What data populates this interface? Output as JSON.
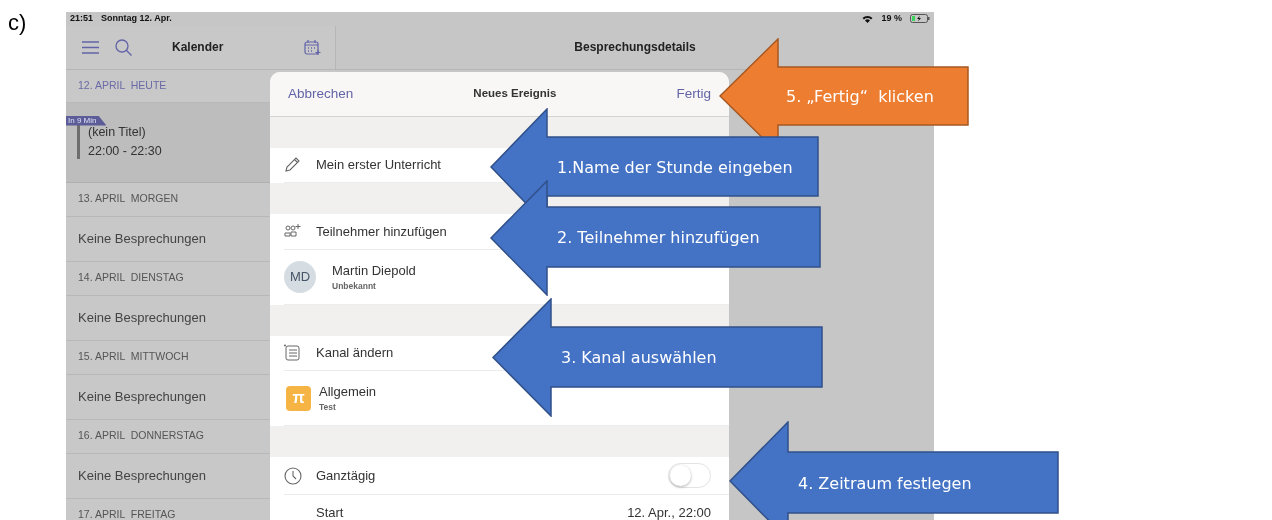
{
  "document_label": "c)",
  "status_bar": {
    "time": "21:51",
    "date": "Sonntag 12. Apr.",
    "battery": "19 %"
  },
  "calendar": {
    "title": "Kalender",
    "days": [
      {
        "header": "12. APRIL  HEUTE",
        "today": true,
        "events": [
          {
            "badge": "In 9 Min",
            "title": "(kein Titel)",
            "time": "22:00 - 22:30"
          }
        ]
      },
      {
        "header": "13. APRIL  MORGEN",
        "today": false,
        "empty_text": "Keine Besprechungen"
      },
      {
        "header": "14. APRIL  DIENSTAG",
        "today": false,
        "empty_text": "Keine Besprechungen"
      },
      {
        "header": "15. APRIL  MITTWOCH",
        "today": false,
        "empty_text": "Keine Besprechungen"
      },
      {
        "header": "16. APRIL  DONNERSTAG",
        "today": false,
        "empty_text": "Keine Besprechungen"
      },
      {
        "header": "17. APRIL  FREITAG",
        "today": false
      }
    ]
  },
  "detail_title": "Besprechungsdetails",
  "sheet": {
    "cancel": "Abbrechen",
    "title": "Neues Ereignis",
    "done": "Fertig",
    "sections": [
      [
        {
          "kind": "input",
          "value": "Mein erster Unterricht"
        }
      ],
      [
        {
          "kind": "action",
          "label": "Teilnehmer hinzufügen"
        },
        {
          "kind": "person",
          "initials": "MD",
          "name": "Martin Diepold",
          "status": "Unbekannt"
        }
      ],
      [
        {
          "kind": "channel_action",
          "label": "Kanal ändern"
        },
        {
          "kind": "channel",
          "glyph": "π",
          "name": "Allgemein",
          "team": "Test"
        }
      ],
      [
        {
          "kind": "toggle",
          "label": "Ganztägig",
          "on": false
        },
        {
          "kind": "datetime",
          "label": "Start",
          "value": "12. Apr., 22:00"
        }
      ]
    ]
  },
  "callouts": [
    {
      "text": "5. „Fertig“  klicken",
      "color": "#ed7d31"
    },
    {
      "text": "1.Name der Stunde eingeben",
      "color": "#4472c4"
    },
    {
      "text": "2. Teilnehmer hinzufügen",
      "color": "#4472c4"
    },
    {
      "text": "3. Kanal auswählen",
      "color": "#4472c4"
    },
    {
      "text": "4. Zeitraum festlegen",
      "color": "#4472c4"
    }
  ]
}
